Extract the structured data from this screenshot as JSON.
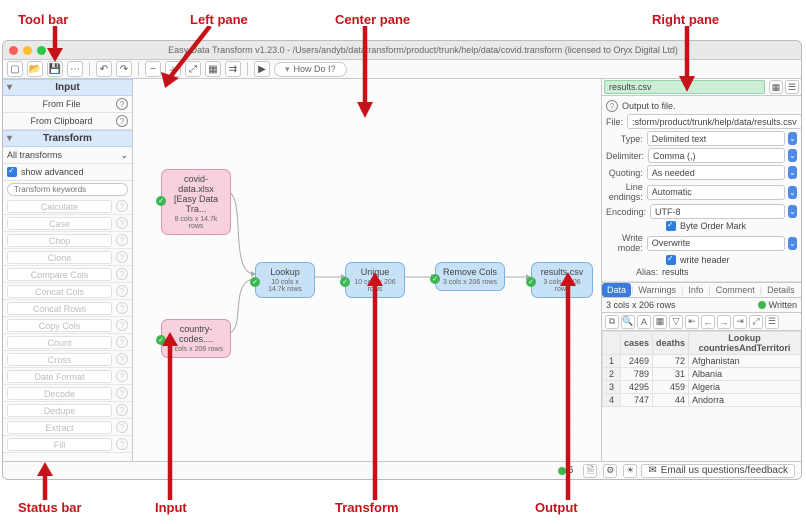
{
  "window": {
    "title": "Easy Data Transform v1.23.0 - /Users/andyb/datatransform/product/trunk/help/data/covid.transform (licensed to Oryx Digital Ltd)"
  },
  "toolbar": {
    "howdoi": "How Do I?"
  },
  "left": {
    "input_header": "Input",
    "from_file": "From File",
    "from_clipboard": "From Clipboard",
    "transform_header": "Transform",
    "all_transforms": "All transforms",
    "show_advanced": "show advanced",
    "search_placeholder": "Transform keywords",
    "ops": [
      "Calculate",
      "Case",
      "Chop",
      "Clone",
      "Compare Cols",
      "Concat Cols",
      "Concat Rows",
      "Copy Cols",
      "Count",
      "Cross",
      "Date Format",
      "Decode",
      "Dedupe",
      "Extract",
      "Fill"
    ]
  },
  "nodes": {
    "covid": {
      "t": "covid-data.xlsx [Easy Data Tra...",
      "s": "8 cols x 14.7k rows"
    },
    "countries": {
      "t": "country-codes....",
      "s": "2 cols x 206 rows"
    },
    "lookup": {
      "t": "Lookup",
      "s": "10 cols x 14.7k rows"
    },
    "unique": {
      "t": "Unique",
      "s": "10 cols x 206 rows"
    },
    "remove": {
      "t": "Remove Cols",
      "s": "3 cols x 206 rows"
    },
    "results": {
      "t": "results.csv",
      "s": "3 cols x 206 rows"
    }
  },
  "right": {
    "filename": "results.csv",
    "output_to_file": "Output to file.",
    "file_label": "File:",
    "file_value": ":sform/product/trunk/help/data/results.csv",
    "type_label": "Type:",
    "type_value": "Delimited text",
    "delimiter_label": "Delimiter:",
    "delimiter_value": "Comma (,)",
    "quoting_label": "Quoting:",
    "quoting_value": "As needed",
    "lineend_label": "Line endings:",
    "lineend_value": "Automatic",
    "encoding_label": "Encoding:",
    "encoding_value": "UTF-8",
    "bom": "Byte Order Mark",
    "writemode_label": "Write mode:",
    "writemode_value": "Overwrite",
    "writeheader": "write header",
    "alias_label": "Alias:",
    "alias_value": "results",
    "tabs": [
      "Data",
      "Warnings",
      "Info",
      "Comment",
      "Details"
    ],
    "rowcount": "3 cols x 206 rows",
    "written": "Written",
    "headers": [
      "",
      "cases",
      "deaths",
      "Lookup countriesAndTerritori"
    ],
    "rows": [
      [
        "1",
        "2469",
        "72",
        "Afghanistan"
      ],
      [
        "2",
        "789",
        "31",
        "Albania"
      ],
      [
        "3",
        "4295",
        "459",
        "Algeria"
      ],
      [
        "4",
        "747",
        "44",
        "Andorra"
      ]
    ]
  },
  "statusbar": {
    "count": "6",
    "feedback": "Email us questions/feedback"
  },
  "annotations": {
    "toolbar": "Tool bar",
    "leftpane": "Left pane",
    "centerpane": "Center pane",
    "rightpane": "Right pane",
    "statusbar": "Status bar",
    "input": "Input",
    "transform": "Transform",
    "output": "Output"
  }
}
